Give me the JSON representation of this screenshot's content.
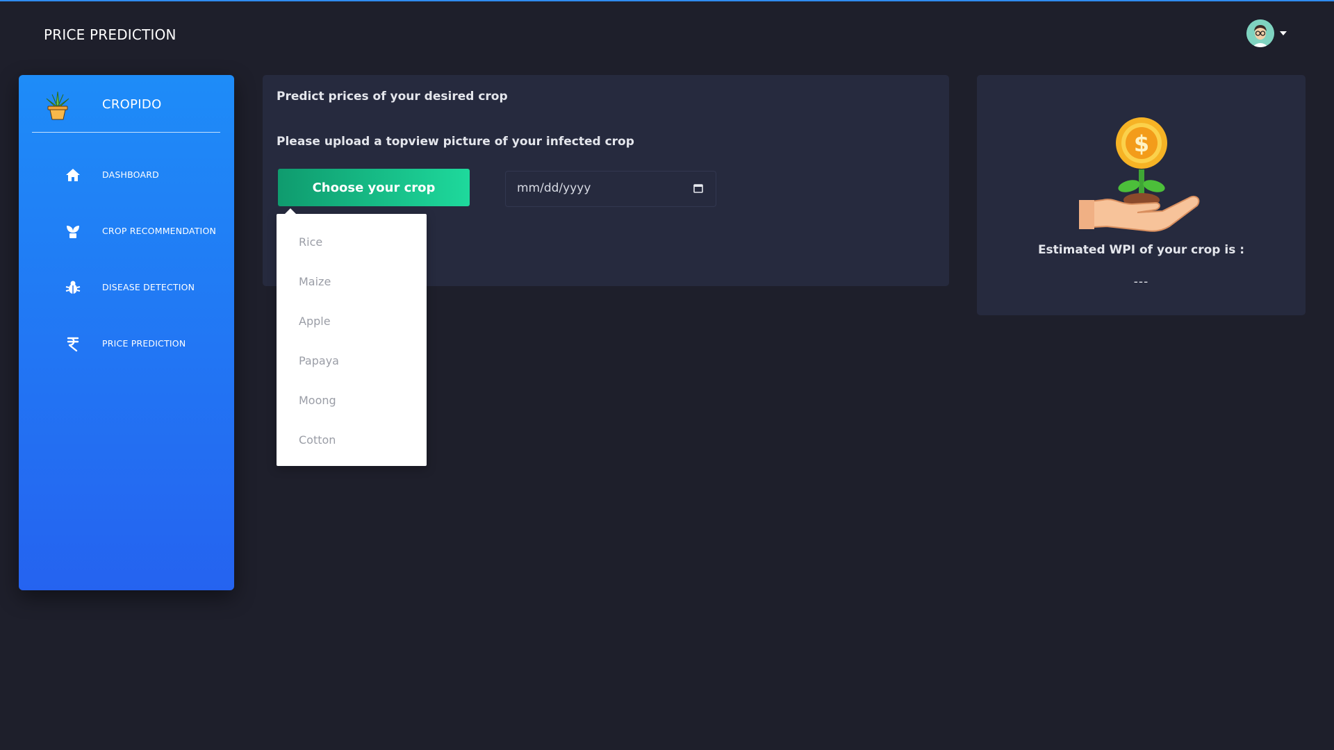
{
  "header": {
    "title": "PRICE PREDICTION"
  },
  "sidebar": {
    "brand": "CROPIDO",
    "items": [
      {
        "label": "DASHBOARD",
        "icon": "home-icon"
      },
      {
        "label": "CROP RECOMMENDATION",
        "icon": "sprout-icon"
      },
      {
        "label": "DISEASE DETECTION",
        "icon": "bug-icon"
      },
      {
        "label": "PRICE PREDICTION",
        "icon": "rupee-icon"
      }
    ]
  },
  "main": {
    "heading": "Predict prices of your desired crop",
    "subheading": "Please upload a topview picture of your infected crop",
    "choose_button": "Choose your crop",
    "date_placeholder": "mm/dd/yyyy",
    "crop_options": [
      "Rice",
      "Maize",
      "Apple",
      "Papaya",
      "Moong",
      "Cotton"
    ]
  },
  "result": {
    "label": "Estimated WPI of your crop is :",
    "value": "---"
  },
  "colors": {
    "background": "#1e1f2b",
    "card": "#262a3e",
    "accent_blue": "#2f8bf0",
    "button_green": "#1ed99c"
  }
}
